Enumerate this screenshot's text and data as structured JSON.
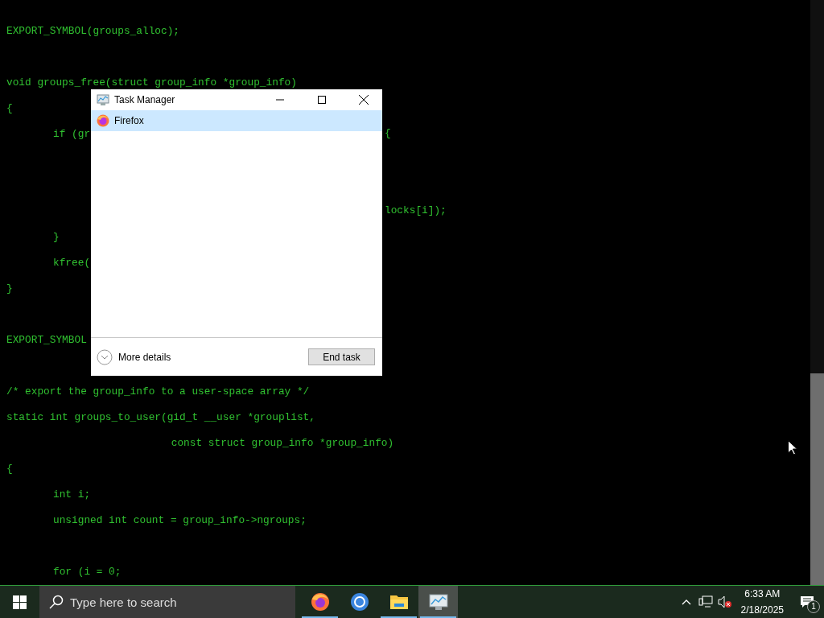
{
  "editor": {
    "lines": [
      {
        "kind": "code",
        "text": "EXPORT_SYMBOL(groups_alloc);"
      },
      {
        "kind": "blank"
      },
      {
        "kind": "code",
        "text": "void groups_free(struct group_info *group_info)"
      },
      {
        "kind": "code",
        "text": "{"
      },
      {
        "kind": "code",
        "text": "\tif (gr",
        "after": "{"
      },
      {
        "kind": "blank"
      },
      {
        "kind": "blank"
      },
      {
        "kind": "code",
        "after": "locks[i]);"
      },
      {
        "kind": "code",
        "text": "\t}"
      },
      {
        "kind": "code",
        "text": "\tkfree("
      },
      {
        "kind": "code",
        "text": "}"
      },
      {
        "kind": "blank"
      },
      {
        "kind": "code",
        "text": "EXPORT_SYMBOL"
      },
      {
        "kind": "blank"
      },
      {
        "kind": "code",
        "text": "/* export the group_info to a user-space array */"
      },
      {
        "kind": "code",
        "text": "static int groups_to_user(gid_t __user *grouplist,"
      },
      {
        "kind": "code",
        "text": "\t\t\t    const struct group_info *group_info)"
      },
      {
        "kind": "code",
        "text": "{"
      },
      {
        "kind": "code",
        "text": "\tint i;"
      },
      {
        "kind": "code",
        "text": "\tunsigned int count = group_info->ngroups;"
      },
      {
        "kind": "blank"
      },
      {
        "kind": "code",
        "text": "\tfor (i = 0;"
      }
    ]
  },
  "dialog": {
    "title": "Task Manager",
    "apps": [
      {
        "name": "Firefox",
        "selected": true
      }
    ],
    "more_details": "More details",
    "end_task": "End task"
  },
  "taskbar": {
    "search": {
      "placeholder": "Type here to search"
    },
    "apps": [
      {
        "kind": "firefox",
        "running": true,
        "active": false
      },
      {
        "kind": "chrome",
        "running": false,
        "active": false
      },
      {
        "kind": "explorer",
        "running": true,
        "active": false
      },
      {
        "kind": "taskmgr",
        "running": true,
        "active": true
      }
    ],
    "clock": {
      "time": "6:33 AM",
      "date": "2/18/2025"
    },
    "notification_count": "1"
  }
}
